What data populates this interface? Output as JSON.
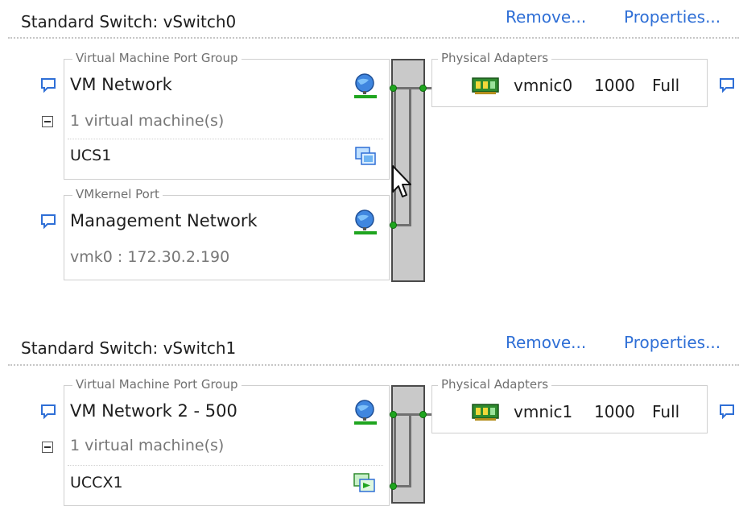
{
  "switches": [
    {
      "title": "Standard Switch: vSwitch0",
      "remove_label": "Remove...",
      "properties_label": "Properties...",
      "port_groups": [
        {
          "legend": "Virtual Machine Port Group",
          "name": "VM Network",
          "vm_count_text": "1 virtual machine(s)",
          "vms": [
            "UCS1"
          ]
        },
        {
          "legend": "VMkernel Port",
          "name": "Management Network",
          "detail": "vmk0 : 172.30.2.190"
        }
      ],
      "adapters": {
        "legend": "Physical Adapters",
        "items": [
          {
            "name": "vmnic0",
            "speed": "1000",
            "duplex": "Full"
          }
        ]
      }
    },
    {
      "title": "Standard Switch: vSwitch1",
      "remove_label": "Remove...",
      "properties_label": "Properties...",
      "port_groups": [
        {
          "legend": "Virtual Machine Port Group",
          "name": "VM Network 2 - 500",
          "vm_count_text": "1 virtual machine(s)",
          "vms": [
            "UCCX1"
          ]
        }
      ],
      "adapters": {
        "legend": "Physical Adapters",
        "items": [
          {
            "name": "vmnic1",
            "speed": "1000",
            "duplex": "Full"
          }
        ]
      }
    }
  ],
  "colors": {
    "link": "#2f6fd6",
    "port_dot": "#1fa51f",
    "trunk_fill": "#c9c9c9",
    "speech_icon": "#2f6fd6"
  },
  "icons": {
    "info": "speech-bubble-icon",
    "network": "network-globe-icon",
    "vm": "virtual-machine-icon",
    "nic": "network-adapter-icon",
    "collapse": "collapse-minus-icon",
    "pointer": "mouse-cursor-icon"
  }
}
